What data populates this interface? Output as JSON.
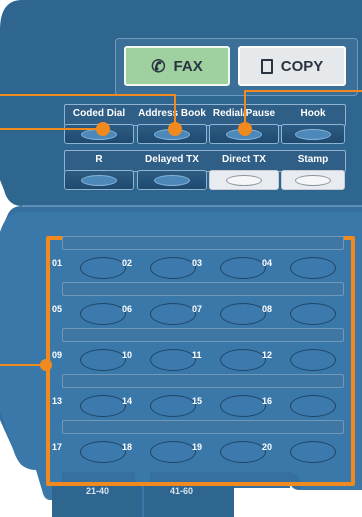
{
  "mode_buttons": {
    "fax": {
      "label": "FAX",
      "icon": "fax-handset-icon"
    },
    "copy": {
      "label": "COPY",
      "icon": "copy-page-icon"
    }
  },
  "function_keys_row1": [
    {
      "label": "Coded Dial"
    },
    {
      "label": "Address Book"
    },
    {
      "label": "Redial/Pause"
    },
    {
      "label": "Hook"
    }
  ],
  "function_keys_row2": [
    {
      "label": "R"
    },
    {
      "label": "Delayed TX"
    },
    {
      "label": "Direct TX"
    },
    {
      "label": "Stamp"
    }
  ],
  "one_touch_keys": [
    "01",
    "02",
    "03",
    "04",
    "05",
    "06",
    "07",
    "08",
    "09",
    "10",
    "11",
    "12",
    "13",
    "14",
    "15",
    "16",
    "17",
    "18",
    "19",
    "20"
  ],
  "bottom_partial_labels": [
    "21-40",
    "41-60"
  ],
  "colors": {
    "panel": "#2f6690",
    "highlight": "#f08a1f",
    "fax_active": "#9fd0a0"
  }
}
